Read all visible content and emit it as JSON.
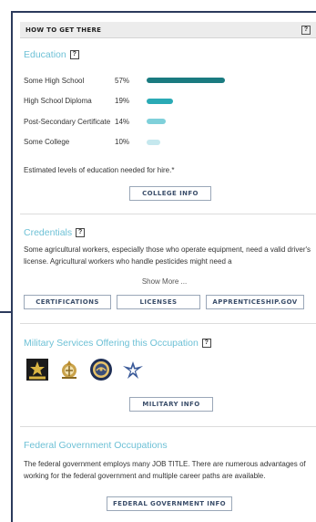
{
  "header": {
    "title": "HOW TO GET THERE",
    "help": "?"
  },
  "education": {
    "title": "Education",
    "help": "?",
    "rows": [
      {
        "label": "Some High School",
        "pct": "57%",
        "value": 57,
        "color": "#1a7b80"
      },
      {
        "label": "High School Diploma",
        "pct": "19%",
        "value": 19,
        "color": "#2aaab5"
      },
      {
        "label": "Post-Secondary Certificate",
        "pct": "14%",
        "value": 14,
        "color": "#7fd0da"
      },
      {
        "label": "Some College",
        "pct": "10%",
        "value": 10,
        "color": "#c5e8ee"
      }
    ],
    "note": "Estimated levels of education needed for hire.*",
    "button": "COLLEGE INFO"
  },
  "credentials": {
    "title": "Credentials",
    "help": "?",
    "text": "Some agricultural workers, especially those who operate equipment, need a valid driver's license. Agricultural workers who handle pesticides might need a",
    "show_more": "Show More ...",
    "buttons": [
      "CERTIFICATIONS",
      "LICENSES",
      "APPRENTICESHIP.GOV"
    ]
  },
  "military": {
    "title": "Military Services Offering this Occupation",
    "help": "?",
    "icons": [
      "army-icon",
      "marines-icon",
      "navy-icon",
      "air-force-icon"
    ],
    "button": "MILITARY INFO"
  },
  "federal": {
    "title": "Federal Government Occupations",
    "text": "The federal government employs many JOB TITLE. There are numerous advantages of working for the federal government and multiple career paths are available.",
    "button": "FEDERAL GOVERNMENT INFO"
  }
}
